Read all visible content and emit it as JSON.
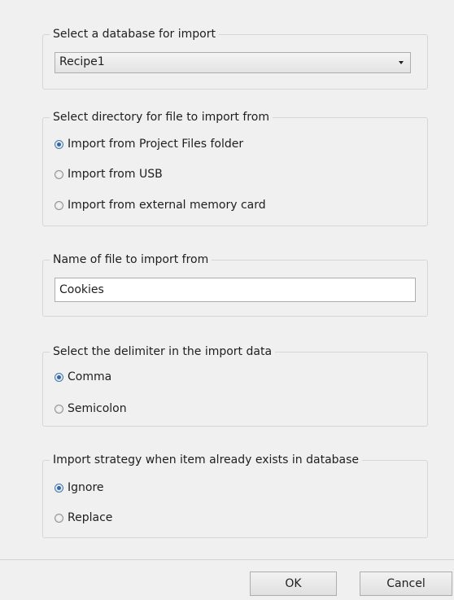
{
  "database_group": {
    "legend": "Select a database for import",
    "selected": "Recipe1"
  },
  "directory_group": {
    "legend": "Select directory for file to import from",
    "options": [
      {
        "label": "Import from Project Files folder",
        "checked": true
      },
      {
        "label": "Import from USB",
        "checked": false
      },
      {
        "label": "Import from external memory card",
        "checked": false
      }
    ]
  },
  "filename_group": {
    "legend": "Name of file to import from",
    "value": "Cookies"
  },
  "delimiter_group": {
    "legend": "Select the delimiter in the import data",
    "options": [
      {
        "label": "Comma",
        "checked": true
      },
      {
        "label": "Semicolon",
        "checked": false
      }
    ]
  },
  "strategy_group": {
    "legend": "Import strategy when item already exists in database",
    "options": [
      {
        "label": "Ignore",
        "checked": true
      },
      {
        "label": "Replace",
        "checked": false
      }
    ]
  },
  "buttons": {
    "ok": "OK",
    "cancel": "Cancel"
  }
}
